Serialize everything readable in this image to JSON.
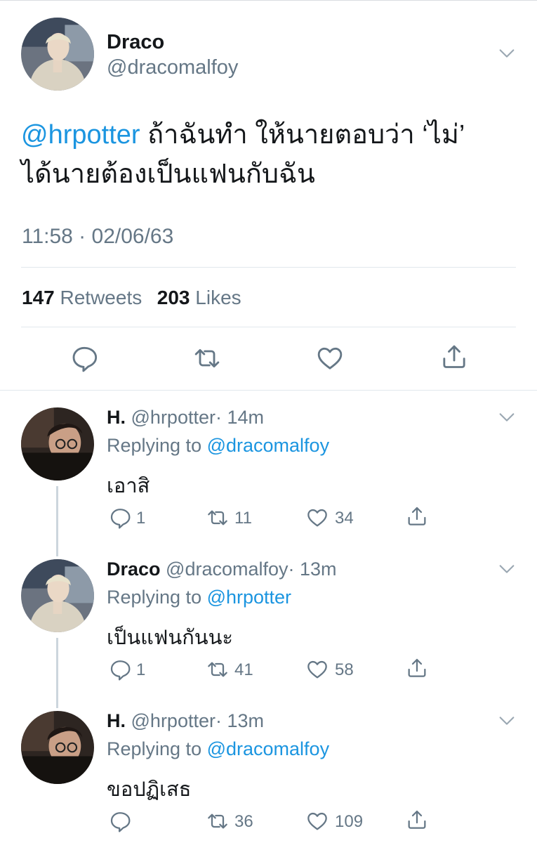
{
  "main_tweet": {
    "name": "Draco",
    "handle": "@dracomalfoy",
    "mention": "@hrpotter",
    "text_line1": " ถ้าฉันทำ ให้นายตอบว่า ‘ไม่’",
    "text_line2": "ได้นายต้องเป็นแฟนกับฉัน",
    "timestamp": "11:58 · 02/06/63",
    "retweets_count": "147",
    "retweets_label": "Retweets",
    "likes_count": "203",
    "likes_label": "Likes"
  },
  "replies": [
    {
      "name": "H.",
      "handle": "@hrpotter",
      "time": "· 14m",
      "replying_prefix": "Replying to ",
      "replying_to": "@dracomalfoy",
      "text": "เอาสิ",
      "replies": "1",
      "retweets": "11",
      "likes": "34"
    },
    {
      "name": "Draco",
      "handle": "@dracomalfoy",
      "time": "· 13m",
      "replying_prefix": "Replying to ",
      "replying_to": "@hrpotter",
      "text": "เป็นแฟนกันนะ",
      "replies": "1",
      "retweets": "41",
      "likes": "58"
    },
    {
      "name": "H.",
      "handle": "@hrpotter",
      "time": "· 13m",
      "replying_prefix": "Replying to ",
      "replying_to": "@dracomalfoy",
      "text": "ขอปฏิเสธ",
      "replies": "",
      "retweets": "36",
      "likes": "109"
    }
  ],
  "icons": {
    "reply": "speech-bubble-icon",
    "retweet": "retweet-icon",
    "like": "heart-icon",
    "share": "share-icon",
    "menu": "chevron-down-icon"
  },
  "colors": {
    "link": "#1b95e0",
    "secondary_text": "#657786",
    "primary_text": "#14171a",
    "divider": "#e1e8ed"
  }
}
